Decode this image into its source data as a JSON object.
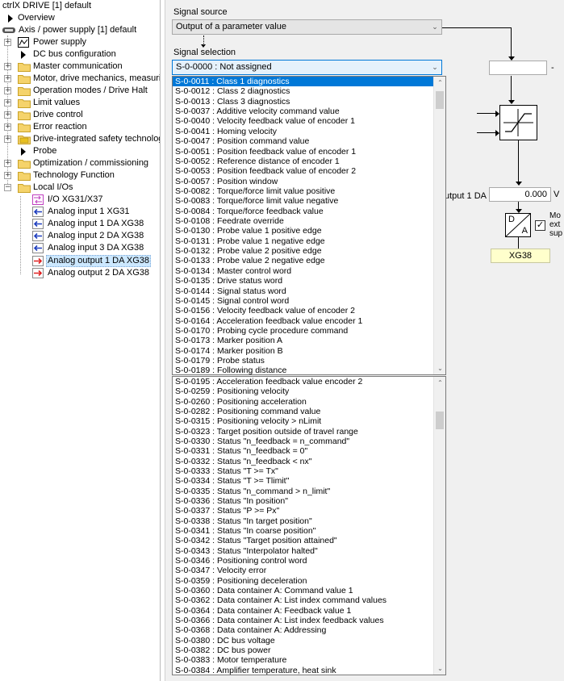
{
  "tree": {
    "title": "ctrlX DRIVE [1] default",
    "items": [
      {
        "label": "Overview"
      },
      {
        "label": "Axis / power supply [1] default"
      },
      {
        "label": "Power supply"
      },
      {
        "label": "DC bus configuration"
      },
      {
        "label": "Master communication"
      },
      {
        "label": "Motor, drive mechanics, measuring"
      },
      {
        "label": "Operation modes / Drive Halt"
      },
      {
        "label": "Limit values"
      },
      {
        "label": "Drive control"
      },
      {
        "label": "Error reaction"
      },
      {
        "label": "Drive-integrated safety technology"
      },
      {
        "label": "Probe"
      },
      {
        "label": "Optimization / commissioning"
      },
      {
        "label": "Technology Function"
      },
      {
        "label": "Local I/Os"
      },
      {
        "label": "I/O XG31/X37"
      },
      {
        "label": "Analog input 1 XG31"
      },
      {
        "label": "Analog input 1 DA XG38"
      },
      {
        "label": "Analog input 2 DA XG38"
      },
      {
        "label": "Analog input 3 DA XG38"
      },
      {
        "label": "Analog output 1 DA XG38"
      },
      {
        "label": "Analog output 2 DA XG38"
      }
    ]
  },
  "panel": {
    "signal_source_label": "Signal source",
    "signal_source_value": "Output of a parameter value",
    "signal_selection_label": "Signal selection",
    "signal_selection_value": "S-0-0000 : Not assigned",
    "output_label": "utput 1 DA",
    "output_value": "0.000",
    "output_unit": "V",
    "top_right_dash": "-",
    "converter_d": "D",
    "converter_a": "A",
    "xg38_label": "XG38",
    "checkbox_text_1": "Mo",
    "checkbox_text_2": "ext",
    "checkbox_text_3": "sup"
  },
  "dropdown1": [
    "S-0-0011 : Class 1 diagnostics",
    "S-0-0012 : Class 2 diagnostics",
    "S-0-0013 : Class 3 diagnostics",
    "S-0-0037 : Additive velocity command value",
    "S-0-0040 : Velocity feedback value of encoder 1",
    "S-0-0041 : Homing velocity",
    "S-0-0047 : Position command value",
    "S-0-0051 : Position feedback value of encoder 1",
    "S-0-0052 : Reference distance of encoder 1",
    "S-0-0053 : Position feedback value of encoder 2",
    "S-0-0057 : Position window",
    "S-0-0082 : Torque/force limit value positive",
    "S-0-0083 : Torque/force limit value negative",
    "S-0-0084 : Torque/force feedback value",
    "S-0-0108 : Feedrate override",
    "S-0-0130 : Probe value 1 positive edge",
    "S-0-0131 : Probe value 1 negative edge",
    "S-0-0132 : Probe value 2 positive edge",
    "S-0-0133 : Probe value 2 negative edge",
    "S-0-0134 : Master control word",
    "S-0-0135 : Drive status word",
    "S-0-0144 : Signal status word",
    "S-0-0145 : Signal control word",
    "S-0-0156 : Velocity feedback value of encoder 2",
    "S-0-0164 : Acceleration feedback value encoder 1",
    "S-0-0170 : Probing cycle procedure command",
    "S-0-0173 : Marker position A",
    "S-0-0174 : Marker position B",
    "S-0-0179 : Probe status",
    "S-0-0189 : Following distance"
  ],
  "dropdown2": [
    "S-0-0195 : Acceleration feedback value encoder 2",
    "S-0-0259 : Positioning velocity",
    "S-0-0260 : Positioning acceleration",
    "S-0-0282 : Positioning command value",
    "S-0-0315 : Positioning velocity > nLimit",
    "S-0-0323 : Target position outside of travel range",
    "S-0-0330 : Status \"n_feedback = n_command\"",
    "S-0-0331 : Status \"n_feedback = 0\"",
    "S-0-0332 : Status \"n_feedback < nx\"",
    "S-0-0333 : Status \"T >= Tx\"",
    "S-0-0334 : Status \"T >= Tlimit\"",
    "S-0-0335 : Status \"n_command > n_limit\"",
    "S-0-0336 : Status \"In position\"",
    "S-0-0337 : Status \"P >= Px\"",
    "S-0-0338 : Status \"In target position\"",
    "S-0-0341 : Status \"In coarse position\"",
    "S-0-0342 : Status \"Target position attained\"",
    "S-0-0343 : Status \"Interpolator halted\"",
    "S-0-0346 : Positioning control word",
    "S-0-0347 : Velocity error",
    "S-0-0359 : Positioning deceleration",
    "S-0-0360 : Data container A: Command value 1",
    "S-0-0362 : Data container A: List index command values",
    "S-0-0364 : Data container A: Feedback value 1",
    "S-0-0366 : Data container A: List index feedback values",
    "S-0-0368 : Data container A: Addressing",
    "S-0-0380 : DC bus voltage",
    "S-0-0382 : DC bus power",
    "S-0-0383 : Motor temperature",
    "S-0-0384 : Amplifier temperature, heat sink"
  ]
}
